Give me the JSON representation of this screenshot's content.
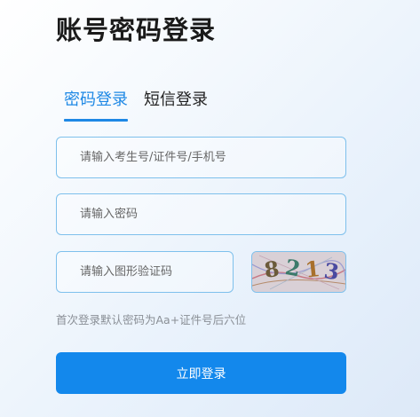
{
  "page": {
    "title": "账号密码登录"
  },
  "tabs": [
    {
      "label": "密码登录",
      "active": true
    },
    {
      "label": "短信登录",
      "active": false
    }
  ],
  "form": {
    "account_placeholder": "请输入考生号/证件号/手机号",
    "account_value": "",
    "password_placeholder": "请输入密码",
    "password_value": "",
    "captcha_placeholder": "请输入图形验证码",
    "captcha_value": "",
    "captcha_text": "8213"
  },
  "hint": "首次登录默认密码为Aa+证件号后六位",
  "submit_label": "立即登录",
  "colors": {
    "accent": "#1e88e5",
    "button": "#1388ec",
    "border": "#7ec0ec",
    "hint_text": "#8a8f96"
  }
}
